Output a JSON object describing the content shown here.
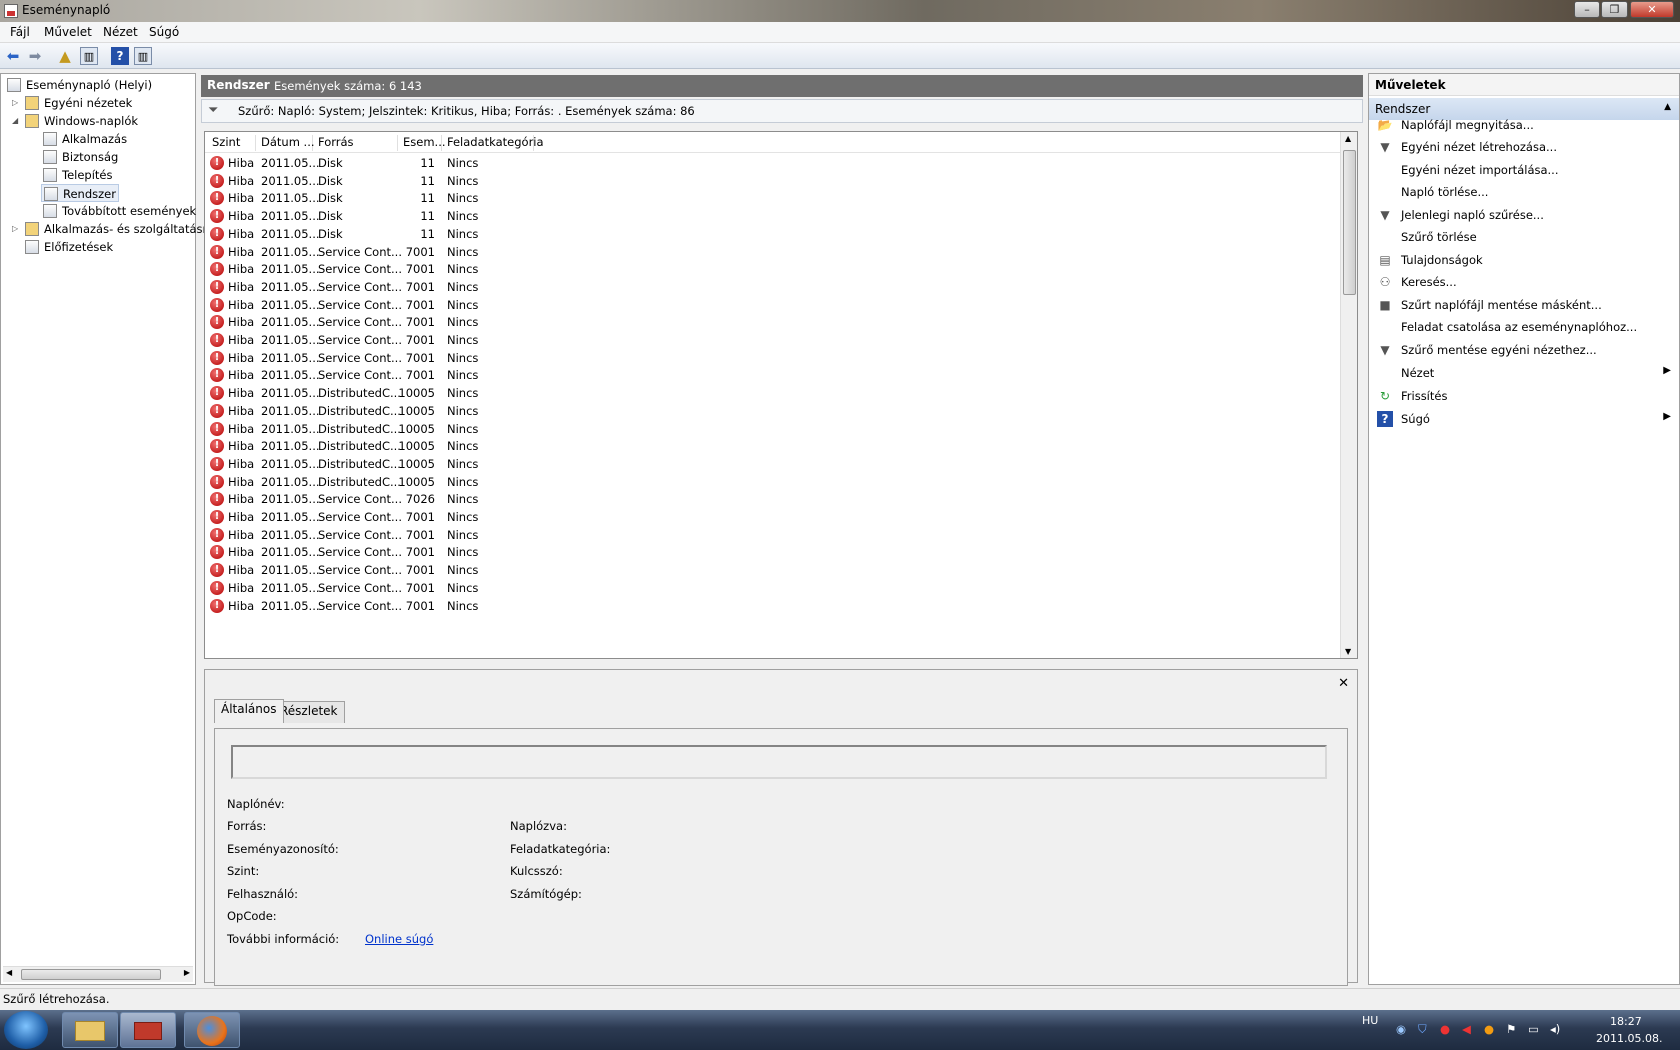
{
  "window": {
    "title": "Eseménynapló"
  },
  "menu": [
    "Fájl",
    "Művelet",
    "Nézet",
    "Súgó"
  ],
  "tree": [
    {
      "label": "Eseménynapló (Helyi)",
      "level": 0
    },
    {
      "label": "Egyéni nézetek",
      "level": 1
    },
    {
      "label": "Windows-naplók",
      "level": 1
    },
    {
      "label": "Alkalmazás",
      "level": 2
    },
    {
      "label": "Biztonság",
      "level": 2
    },
    {
      "label": "Telepítés",
      "level": 2
    },
    {
      "label": "Rendszer",
      "level": 2,
      "selected": true
    },
    {
      "label": "Továbbított események",
      "level": 2
    },
    {
      "label": "Alkalmazás- és szolgáltatásn",
      "level": 1
    },
    {
      "label": "Előfizetések",
      "level": 1
    }
  ],
  "center": {
    "header_title": "Rendszer",
    "header_count": "Események száma: 6 143",
    "filter_text": "Szűrő: Napló: System; Jelszintek: Kritikus, Hiba; Forrás: . Események száma: 86"
  },
  "grid": {
    "columns": [
      "Szint",
      "Dátum ...",
      "Forrás",
      "Esem...",
      "Feladatkategória"
    ],
    "rows": [
      [
        "Hiba",
        "2011.05...",
        "Disk",
        "11",
        "Nincs"
      ],
      [
        "Hiba",
        "2011.05...",
        "Disk",
        "11",
        "Nincs"
      ],
      [
        "Hiba",
        "2011.05...",
        "Disk",
        "11",
        "Nincs"
      ],
      [
        "Hiba",
        "2011.05...",
        "Disk",
        "11",
        "Nincs"
      ],
      [
        "Hiba",
        "2011.05...",
        "Disk",
        "11",
        "Nincs"
      ],
      [
        "Hiba",
        "2011.05...",
        "Service Cont...",
        "7001",
        "Nincs"
      ],
      [
        "Hiba",
        "2011.05...",
        "Service Cont...",
        "7001",
        "Nincs"
      ],
      [
        "Hiba",
        "2011.05...",
        "Service Cont...",
        "7001",
        "Nincs"
      ],
      [
        "Hiba",
        "2011.05...",
        "Service Cont...",
        "7001",
        "Nincs"
      ],
      [
        "Hiba",
        "2011.05...",
        "Service Cont...",
        "7001",
        "Nincs"
      ],
      [
        "Hiba",
        "2011.05...",
        "Service Cont...",
        "7001",
        "Nincs"
      ],
      [
        "Hiba",
        "2011.05...",
        "Service Cont...",
        "7001",
        "Nincs"
      ],
      [
        "Hiba",
        "2011.05...",
        "Service Cont...",
        "7001",
        "Nincs"
      ],
      [
        "Hiba",
        "2011.05...",
        "DistributedC...",
        "10005",
        "Nincs"
      ],
      [
        "Hiba",
        "2011.05...",
        "DistributedC...",
        "10005",
        "Nincs"
      ],
      [
        "Hiba",
        "2011.05...",
        "DistributedC...",
        "10005",
        "Nincs"
      ],
      [
        "Hiba",
        "2011.05...",
        "DistributedC...",
        "10005",
        "Nincs"
      ],
      [
        "Hiba",
        "2011.05...",
        "DistributedC...",
        "10005",
        "Nincs"
      ],
      [
        "Hiba",
        "2011.05...",
        "DistributedC...",
        "10005",
        "Nincs"
      ],
      [
        "Hiba",
        "2011.05...",
        "Service Cont...",
        "7026",
        "Nincs"
      ],
      [
        "Hiba",
        "2011.05...",
        "Service Cont...",
        "7001",
        "Nincs"
      ],
      [
        "Hiba",
        "2011.05...",
        "Service Cont...",
        "7001",
        "Nincs"
      ],
      [
        "Hiba",
        "2011.05...",
        "Service Cont...",
        "7001",
        "Nincs"
      ],
      [
        "Hiba",
        "2011.05...",
        "Service Cont...",
        "7001",
        "Nincs"
      ],
      [
        "Hiba",
        "2011.05...",
        "Service Cont...",
        "7001",
        "Nincs"
      ],
      [
        "Hiba",
        "2011.05...",
        "Service Cont...",
        "7001",
        "Nincs"
      ]
    ]
  },
  "detail": {
    "tabs": [
      "Általános",
      "Részletek"
    ],
    "left_labels": [
      "Naplónév:",
      "Forrás:",
      "Eseményazonosító:",
      "Szint:",
      "Felhasználó:",
      "OpCode:",
      "További információ:"
    ],
    "right_labels": [
      "Naplózva:",
      "Feladatkategória:",
      "Kulcsszó:",
      "Számítógép:"
    ],
    "link": "Online súgó"
  },
  "actions": {
    "title": "Műveletek",
    "group": "Rendszer",
    "items": [
      {
        "label": "Naplófájl megnyitása...",
        "icon": "folder-open-icon",
        "glyph": "📂"
      },
      {
        "label": "Egyéni nézet létrehozása...",
        "icon": "filter-icon",
        "glyph": "▼"
      },
      {
        "label": "Egyéni nézet importálása...",
        "icon": "",
        "glyph": ""
      },
      {
        "label": "Napló törlése...",
        "icon": "",
        "glyph": ""
      },
      {
        "label": "Jelenlegi napló szűrése...",
        "icon": "filter-icon",
        "glyph": "▼"
      },
      {
        "label": "Szűrő törlése",
        "icon": "",
        "glyph": ""
      },
      {
        "label": "Tulajdonságok",
        "icon": "properties-icon",
        "glyph": "▤"
      },
      {
        "label": "Keresés...",
        "icon": "binoculars-icon",
        "glyph": "⚇"
      },
      {
        "label": "Szűrt naplófájl mentése másként...",
        "icon": "save-icon",
        "glyph": "■"
      },
      {
        "label": "Feladat csatolása az eseménynaplóhoz...",
        "icon": "",
        "glyph": ""
      },
      {
        "label": "Szűrő mentése egyéni nézethez...",
        "icon": "filter-save-icon",
        "glyph": "▼"
      },
      {
        "label": "Nézet",
        "icon": "",
        "glyph": "",
        "submenu": true
      },
      {
        "label": "Frissítés",
        "icon": "refresh-icon",
        "glyph": "↻"
      },
      {
        "label": "Súgó",
        "icon": "help-icon",
        "glyph": "?",
        "submenu": true
      }
    ]
  },
  "status": {
    "text": "Szűrő létrehozása."
  },
  "taskbar": {
    "language": "HU",
    "time": "18:27",
    "date": "2011.05.08."
  }
}
